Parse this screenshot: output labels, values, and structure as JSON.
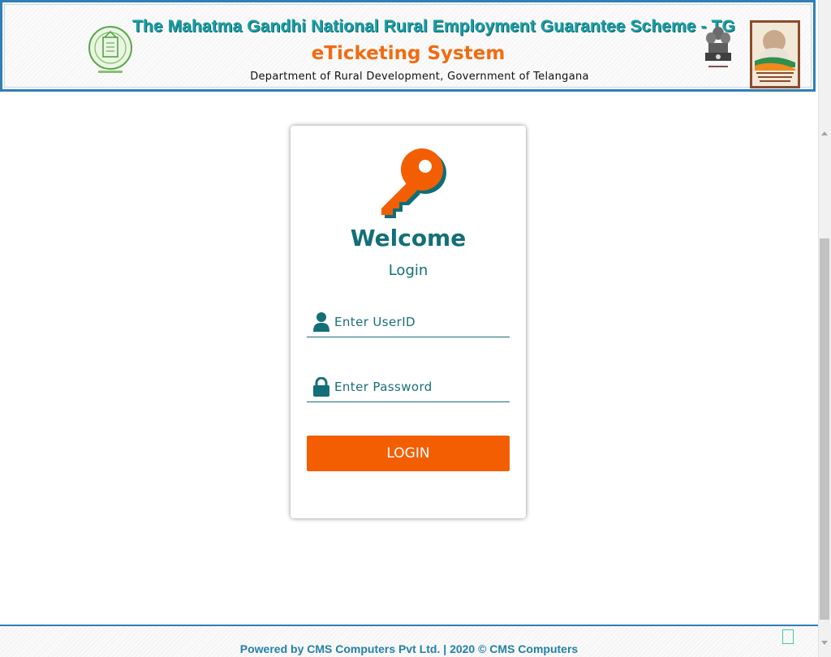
{
  "header": {
    "title": "The Mahatma Gandhi National Rural Employment Guarantee Scheme - TG",
    "subtitle": "eTicketing System",
    "department": "Department of Rural Development, Government of Telangana"
  },
  "login": {
    "welcome": "Welcome",
    "heading": "Login",
    "userid_placeholder": "Enter UserID",
    "password_placeholder": "Enter Password",
    "button_label": "LOGIN"
  },
  "footer": {
    "text": "Powered by CMS Computers Pvt Ltd. | 2020 © CMS Computers"
  },
  "icons": {
    "key": "key-icon",
    "user": "user-icon",
    "lock": "lock-icon"
  },
  "colors": {
    "accent_orange": "#f45e03",
    "teal": "#136f78",
    "header_border": "#2f7fb8"
  }
}
